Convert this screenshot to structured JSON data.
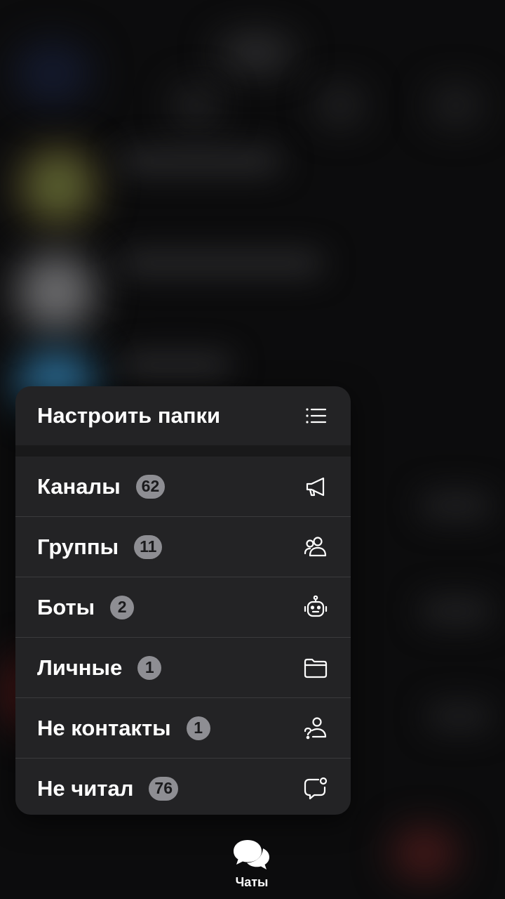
{
  "menu": {
    "configure_label": "Настроить папки",
    "folders": [
      {
        "label": "Каналы",
        "badge": "62",
        "icon": "megaphone-icon"
      },
      {
        "label": "Группы",
        "badge": "11",
        "icon": "people-icon"
      },
      {
        "label": "Боты",
        "badge": "2",
        "icon": "robot-icon"
      },
      {
        "label": "Личные",
        "badge": "1",
        "icon": "folder-icon"
      },
      {
        "label": "Не контакты",
        "badge": "1",
        "icon": "unknown-person-icon"
      },
      {
        "label": "Не читал",
        "badge": "76",
        "icon": "unread-bubble-icon"
      }
    ]
  },
  "tabbar": {
    "chats_label": "Чаты"
  },
  "colors": {
    "menu_bg": "#232325",
    "badge_bg": "#8e8e93",
    "text": "#ffffff",
    "background": "#0c0c0d"
  }
}
